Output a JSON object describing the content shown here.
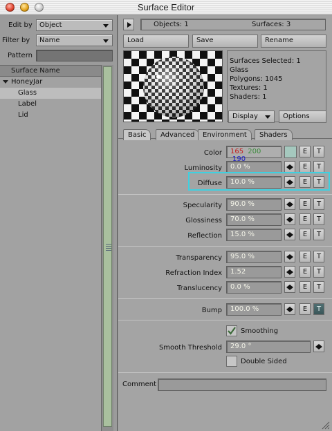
{
  "window": {
    "title": "Surface Editor"
  },
  "left": {
    "edit_by": {
      "label": "Edit by",
      "value": "Object"
    },
    "filter_by": {
      "label": "Filter by",
      "value": "Name"
    },
    "pattern": {
      "label": "Pattern",
      "value": ""
    },
    "list_header": "Surface Name",
    "tree": [
      {
        "label": "HoneyJar",
        "type": "group",
        "expanded": true
      },
      {
        "label": "Glass",
        "type": "child",
        "selected": true
      },
      {
        "label": "Label",
        "type": "child",
        "selected": false
      },
      {
        "label": "Lid",
        "type": "child",
        "selected": false
      }
    ]
  },
  "header": {
    "objects_text": "Objects: 1",
    "surfaces_text": "Surfaces: 3"
  },
  "toolbar": {
    "load": "Load",
    "save": "Save",
    "rename": "Rename"
  },
  "info": {
    "lines": [
      "Surfaces Selected: 1",
      "Glass",
      "Polygons: 1045",
      "Textures: 1",
      "Shaders: 1"
    ]
  },
  "preview_controls": {
    "display": "Display",
    "options": "Options"
  },
  "tabs": [
    {
      "label": "Basic",
      "selected": true
    },
    {
      "label": "Advanced",
      "selected": false
    },
    {
      "label": "Environment",
      "selected": false
    },
    {
      "label": "Shaders",
      "selected": false
    }
  ],
  "props": {
    "color": {
      "label": "Color",
      "r": "165",
      "g": "200",
      "b": "190",
      "r_color": "#c41c1c",
      "g_color": "#3c8c3c",
      "b_color": "#1c1cc4",
      "swatch": "#a5c8be"
    },
    "luminosity": {
      "label": "Luminosity",
      "value": "0.0 %"
    },
    "diffuse": {
      "label": "Diffuse",
      "value": "10.0 %"
    },
    "specularity": {
      "label": "Specularity",
      "value": "90.0 %"
    },
    "glossiness": {
      "label": "Glossiness",
      "value": "70.0 %"
    },
    "reflection": {
      "label": "Reflection",
      "value": "15.0 %"
    },
    "transparency": {
      "label": "Transparency",
      "value": "95.0 %"
    },
    "refraction_index": {
      "label": "Refraction Index",
      "value": "1.52"
    },
    "translucency": {
      "label": "Translucency",
      "value": "0.0 %"
    },
    "bump": {
      "label": "Bump",
      "value": "100.0 %"
    },
    "smoothing": {
      "label": "Smoothing",
      "checked": true
    },
    "smooth_threshold": {
      "label": "Smooth Threshold",
      "value": "29.0 °"
    },
    "double_sided": {
      "label": "Double Sided",
      "checked": false
    }
  },
  "button_labels": {
    "e": "E",
    "t": "T"
  },
  "comment": {
    "label": "Comment",
    "value": ""
  },
  "colors": {
    "highlight": "#3fd0e0",
    "panel": "#a4a4a4"
  }
}
